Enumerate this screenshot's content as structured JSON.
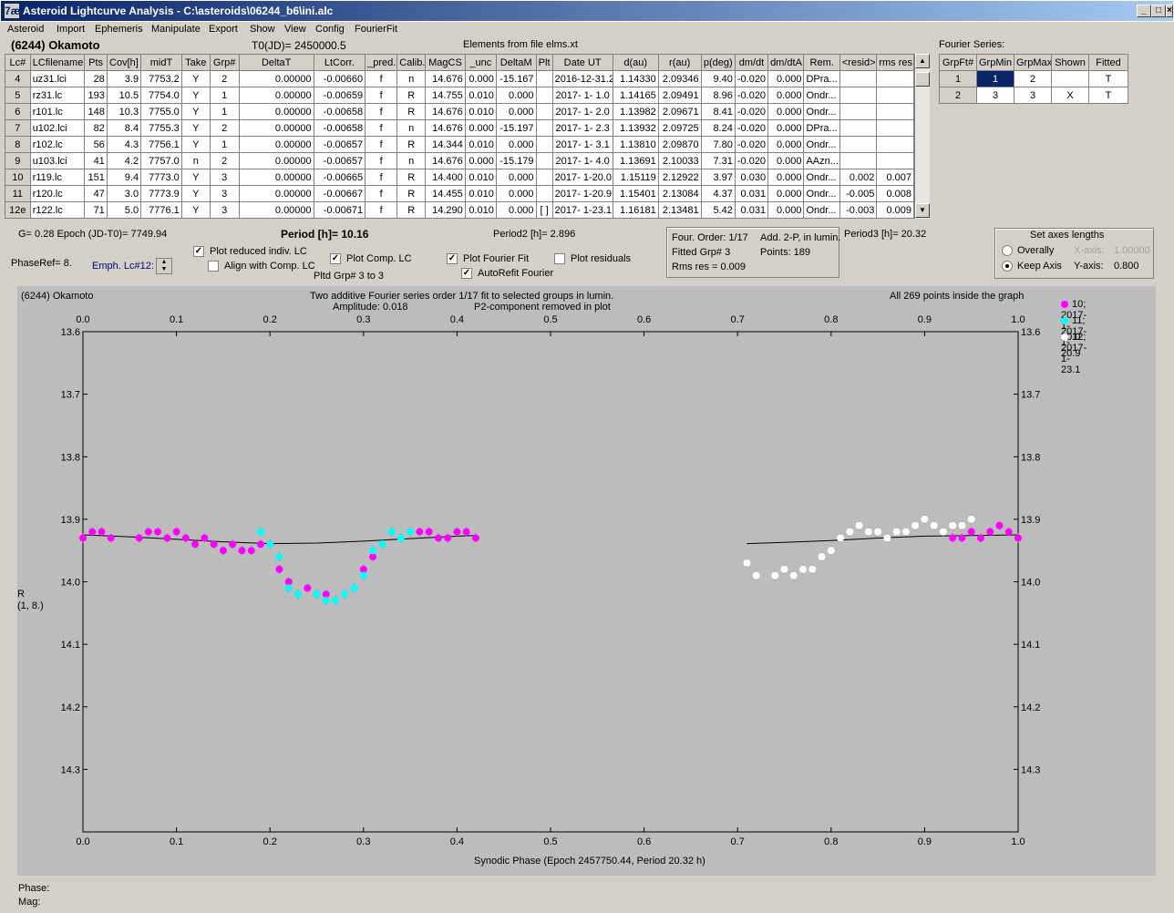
{
  "window": {
    "title": "Asteroid Lightcurve Analysis - C:\\asteroids\\06244_b6\\ini.alc",
    "app_icon": "7æ"
  },
  "menu": [
    "Asteroid",
    "Import",
    "Ephemeris",
    "Manipulate",
    "Export",
    "Show",
    "View",
    "Config",
    "FourierFit"
  ],
  "header": {
    "asteroid": "(6244) Okamoto",
    "t0": "T0(JD)= 2450000.5",
    "elements": "Elements from file elms.xt",
    "fourier_title": "Fourier Series:"
  },
  "lc_table": {
    "columns": [
      "Lc#",
      "LCfilename",
      "Pts",
      "Cov[h]",
      "midT",
      "Take",
      "Grp#",
      "DeltaT",
      "LtCorr.",
      "_pred.",
      "Calib.",
      "MagCS",
      "_unc",
      "DeltaM",
      "Plt",
      "Date UT",
      "d(au)",
      "r(au)",
      "p(deg)",
      "dm/dt",
      "dm/dtA",
      "Rem.",
      "<resid>",
      "rms res"
    ],
    "rows": [
      [
        "4",
        "uz31.lci",
        "28",
        "3.9",
        "7753.2",
        "Y",
        "2",
        "0.00000",
        "-0.00660",
        "f",
        "n",
        "14.676",
        "0.000",
        "-15.167",
        "",
        "2016-12-31.2",
        "1.14330",
        "2.09346",
        "9.40",
        "-0.020",
        "0.000",
        "DPra...",
        "",
        ""
      ],
      [
        "5",
        "rz31.lc",
        "193",
        "10.5",
        "7754.0",
        "Y",
        "1",
        "0.00000",
        "-0.00659",
        "f",
        "R",
        "14.755",
        "0.010",
        "0.000",
        "",
        "2017- 1- 1.0",
        "1.14165",
        "2.09491",
        "8.96",
        "-0.020",
        "0.000",
        "Ondr...",
        "",
        ""
      ],
      [
        "6",
        "r101.lc",
        "148",
        "10.3",
        "7755.0",
        "Y",
        "1",
        "0.00000",
        "-0.00658",
        "f",
        "R",
        "14.676",
        "0.010",
        "0.000",
        "",
        "2017- 1- 2.0",
        "1.13982",
        "2.09671",
        "8.41",
        "-0.020",
        "0.000",
        "Ondr...",
        "",
        ""
      ],
      [
        "7",
        "u102.lci",
        "82",
        "8.4",
        "7755.3",
        "Y",
        "2",
        "0.00000",
        "-0.00658",
        "f",
        "n",
        "14.676",
        "0.000",
        "-15.197",
        "",
        "2017- 1- 2.3",
        "1.13932",
        "2.09725",
        "8.24",
        "-0.020",
        "0.000",
        "DPra...",
        "",
        ""
      ],
      [
        "8",
        "r102.lc",
        "56",
        "4.3",
        "7756.1",
        "Y",
        "1",
        "0.00000",
        "-0.00657",
        "f",
        "R",
        "14.344",
        "0.010",
        "0.000",
        "",
        "2017- 1- 3.1",
        "1.13810",
        "2.09870",
        "7.80",
        "-0.020",
        "0.000",
        "Ondr...",
        "",
        ""
      ],
      [
        "9",
        "u103.lci",
        "41",
        "4.2",
        "7757.0",
        "n",
        "2",
        "0.00000",
        "-0.00657",
        "f",
        "n",
        "14.676",
        "0.000",
        "-15.179",
        "",
        "2017- 1- 4.0",
        "1.13691",
        "2.10033",
        "7.31",
        "-0.020",
        "0.000",
        "AAzn...",
        "",
        ""
      ],
      [
        "10",
        "r119.lc",
        "151",
        "9.4",
        "7773.0",
        "Y",
        "3",
        "0.00000",
        "-0.00665",
        "f",
        "R",
        "14.400",
        "0.010",
        "0.000",
        "",
        "2017- 1-20.0",
        "1.15119",
        "2.12922",
        "3.97",
        "0.030",
        "0.000",
        "Ondr...",
        "0.002",
        "0.007"
      ],
      [
        "11",
        "r120.lc",
        "47",
        "3.0",
        "7773.9",
        "Y",
        "3",
        "0.00000",
        "-0.00667",
        "f",
        "R",
        "14.455",
        "0.010",
        "0.000",
        "",
        "2017- 1-20.9",
        "1.15401",
        "2.13084",
        "4.37",
        "0.031",
        "0.000",
        "Ondr...",
        "-0.005",
        "0.008"
      ],
      [
        "12e",
        "r122.lc",
        "71",
        "5.0",
        "7776.1",
        "Y",
        "3",
        "0.00000",
        "-0.00671",
        "f",
        "R",
        "14.290",
        "0.010",
        "0.000",
        "[ ]",
        "2017- 1-23.1",
        "1.16181",
        "2.13481",
        "5.42",
        "0.031",
        "0.000",
        "Ondr...",
        "-0.003",
        "0.009"
      ]
    ]
  },
  "fourier_table": {
    "columns": [
      "GrpFt#",
      "GrpMin",
      "GrpMax",
      "Shown",
      "Fitted"
    ],
    "rows": [
      [
        "1",
        "1",
        "2",
        "",
        "T"
      ],
      [
        "2",
        "3",
        "3",
        "X",
        "T"
      ]
    ]
  },
  "info": {
    "g_line": "G= 0.28   Epoch (JD-T0)= 7749.94",
    "period": "Period [h]= 10.16",
    "period2": "Period2 [h]= 2.896",
    "period3": "Period3 [h]= 20.32",
    "phaseref": "PhaseRef= 8.",
    "emph": "Emph. Lc#12:",
    "pltd_grp": "Pltd Grp#  3  to  3",
    "four_order": "Four. Order:  1/17",
    "add2p": "Add. 2-P, in lumin.",
    "fitted_grp": "Fitted Grp# 3",
    "points": "Points: 189",
    "rms": "Rms res     = 0.009"
  },
  "checkboxes": {
    "plot_reduced": {
      "label": "Plot reduced indiv. LC",
      "checked": true
    },
    "align_comp": {
      "label": "Align with Comp. LC",
      "checked": false
    },
    "plot_comp": {
      "label": "Plot Comp. LC",
      "checked": true
    },
    "plot_fourier": {
      "label": "Plot Fourier Fit",
      "checked": true
    },
    "plot_resid": {
      "label": "Plot residuals",
      "checked": false
    },
    "autorefit": {
      "label": "AutoRefit Fourier",
      "checked": true
    }
  },
  "axes_box": {
    "title": "Set axes lengths",
    "overally": "Overally",
    "keep_axis": "Keep Axis",
    "x_label": "X-axis:",
    "x_value": "1.00000",
    "y_label": "Y-axis:",
    "y_value": "0.800"
  },
  "plot_header": {
    "name": "(6244) Okamoto",
    "line1": "Two additive Fourier series order 1/17 fit to selected groups in lumin.",
    "line2": "Amplitude: 0.018",
    "line3": "P2-component removed in plot",
    "inside": "All 269 points inside the graph"
  },
  "status": {
    "phase": "Phase:",
    "mag": "Mag:"
  },
  "chart_data": {
    "type": "scatter",
    "xlabel": "Synodic Phase (Epoch 2457750.44, Period 20.32 h)",
    "ylabel": "R\n(1, 8.)",
    "xlim": [
      0,
      1
    ],
    "ylim": [
      14.4,
      13.6
    ],
    "x_ticks": [
      "0.0",
      "0.1",
      "0.2",
      "0.3",
      "0.4",
      "0.5",
      "0.6",
      "0.7",
      "0.8",
      "0.9",
      "1.0"
    ],
    "y_ticks": [
      "13.6",
      "13.7",
      "13.8",
      "13.9",
      "14.0",
      "14.1",
      "14.2",
      "14.3"
    ],
    "grid": false,
    "legend_position": "top-right",
    "series": [
      {
        "name": "10; 2017- 1-20.0",
        "color": "#ff00ff",
        "points": [
          [
            0.0,
            13.93
          ],
          [
            0.01,
            13.92
          ],
          [
            0.02,
            13.92
          ],
          [
            0.03,
            13.93
          ],
          [
            0.06,
            13.93
          ],
          [
            0.07,
            13.92
          ],
          [
            0.08,
            13.92
          ],
          [
            0.09,
            13.93
          ],
          [
            0.1,
            13.92
          ],
          [
            0.11,
            13.93
          ],
          [
            0.12,
            13.94
          ],
          [
            0.13,
            13.93
          ],
          [
            0.14,
            13.94
          ],
          [
            0.15,
            13.95
          ],
          [
            0.16,
            13.94
          ],
          [
            0.17,
            13.95
          ],
          [
            0.18,
            13.95
          ],
          [
            0.19,
            13.94
          ],
          [
            0.21,
            13.98
          ],
          [
            0.22,
            14.0
          ],
          [
            0.23,
            14.02
          ],
          [
            0.24,
            14.01
          ],
          [
            0.25,
            14.02
          ],
          [
            0.26,
            14.02
          ],
          [
            0.3,
            13.98
          ],
          [
            0.31,
            13.96
          ],
          [
            0.36,
            13.92
          ],
          [
            0.37,
            13.92
          ],
          [
            0.38,
            13.93
          ],
          [
            0.39,
            13.93
          ],
          [
            0.4,
            13.92
          ],
          [
            0.41,
            13.92
          ],
          [
            0.42,
            13.93
          ],
          [
            0.93,
            13.93
          ],
          [
            0.94,
            13.93
          ],
          [
            0.95,
            13.92
          ],
          [
            0.96,
            13.93
          ],
          [
            0.97,
            13.92
          ],
          [
            0.98,
            13.91
          ],
          [
            0.99,
            13.92
          ],
          [
            1.0,
            13.93
          ]
        ]
      },
      {
        "name": "11; 2017- 1-20.9",
        "color": "#00ffff",
        "points": [
          [
            0.19,
            13.92
          ],
          [
            0.2,
            13.94
          ],
          [
            0.21,
            13.96
          ],
          [
            0.22,
            14.01
          ],
          [
            0.23,
            14.02
          ],
          [
            0.25,
            14.02
          ],
          [
            0.26,
            14.03
          ],
          [
            0.27,
            14.03
          ],
          [
            0.28,
            14.02
          ],
          [
            0.29,
            14.01
          ],
          [
            0.3,
            13.99
          ],
          [
            0.31,
            13.95
          ],
          [
            0.32,
            13.94
          ],
          [
            0.33,
            13.92
          ],
          [
            0.34,
            13.93
          ],
          [
            0.35,
            13.92
          ]
        ]
      },
      {
        "name": "12; 2017- 1-23.1",
        "color": "#ffffff",
        "points": [
          [
            0.71,
            13.97
          ],
          [
            0.72,
            13.99
          ],
          [
            0.74,
            13.99
          ],
          [
            0.75,
            13.98
          ],
          [
            0.76,
            13.99
          ],
          [
            0.77,
            13.98
          ],
          [
            0.78,
            13.98
          ],
          [
            0.79,
            13.96
          ],
          [
            0.8,
            13.95
          ],
          [
            0.81,
            13.93
          ],
          [
            0.82,
            13.92
          ],
          [
            0.83,
            13.91
          ],
          [
            0.84,
            13.92
          ],
          [
            0.85,
            13.92
          ],
          [
            0.86,
            13.93
          ],
          [
            0.87,
            13.92
          ],
          [
            0.88,
            13.92
          ],
          [
            0.89,
            13.91
          ],
          [
            0.9,
            13.9
          ],
          [
            0.91,
            13.91
          ],
          [
            0.92,
            13.92
          ],
          [
            0.93,
            13.91
          ],
          [
            0.94,
            13.91
          ],
          [
            0.95,
            13.9
          ]
        ]
      }
    ],
    "fit_curves": [
      {
        "points": [
          [
            0.0,
            13.925
          ],
          [
            0.05,
            13.928
          ],
          [
            0.1,
            13.932
          ],
          [
            0.15,
            13.936
          ],
          [
            0.2,
            13.939
          ],
          [
            0.25,
            13.938
          ],
          [
            0.3,
            13.935
          ],
          [
            0.35,
            13.931
          ],
          [
            0.4,
            13.927
          ],
          [
            0.42,
            13.926
          ]
        ]
      },
      {
        "points": [
          [
            0.71,
            13.939
          ],
          [
            0.75,
            13.937
          ],
          [
            0.8,
            13.934
          ],
          [
            0.85,
            13.93
          ],
          [
            0.9,
            13.927
          ],
          [
            0.95,
            13.926
          ],
          [
            1.0,
            13.925
          ]
        ]
      }
    ]
  }
}
